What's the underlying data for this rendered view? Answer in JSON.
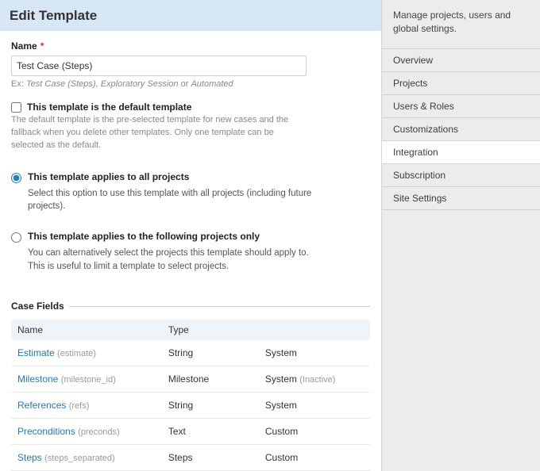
{
  "header": {
    "title": "Edit Template"
  },
  "name": {
    "label": "Name",
    "value": "Test Case (Steps)",
    "hint_prefix": "Ex: ",
    "hint_em": "Test Case (Steps), Exploratory Session",
    "hint_or": " or ",
    "hint_auto": "Automated"
  },
  "default_chk": {
    "label": "This template is the default template",
    "desc": "The default template is the pre-selected template for new cases and the fallback when you delete other templates. Only one template can be selected as the default.",
    "checked": false
  },
  "scope": {
    "all": {
      "label": "This template applies to all projects",
      "desc": "Select this option to use this template with all projects (including future projects)."
    },
    "some": {
      "label": "This template applies to the following projects only",
      "desc": "You can alternatively select the projects this template should apply to. This is useful to limit a template to select projects."
    },
    "selected": "all"
  },
  "case_fields": {
    "legend": "Case Fields",
    "columns": {
      "name": "Name",
      "type": "Type",
      "source": ""
    },
    "rows": [
      {
        "label": "Estimate",
        "system_name": "(estimate)",
        "type": "String",
        "source": "System",
        "inactive": ""
      },
      {
        "label": "Milestone",
        "system_name": "(milestone_id)",
        "type": "Milestone",
        "source": "System",
        "inactive": "(Inactive)"
      },
      {
        "label": "References",
        "system_name": "(refs)",
        "type": "String",
        "source": "System",
        "inactive": ""
      },
      {
        "label": "Preconditions",
        "system_name": "(preconds)",
        "type": "Text",
        "source": "Custom",
        "inactive": ""
      },
      {
        "label": "Steps",
        "system_name": "(steps_separated)",
        "type": "Steps",
        "source": "Custom",
        "inactive": ""
      }
    ]
  },
  "sidebar": {
    "title": "Manage projects, users and global settings.",
    "items": [
      {
        "label": "Overview",
        "active": false
      },
      {
        "label": "Projects",
        "active": false
      },
      {
        "label": "Users & Roles",
        "active": false
      },
      {
        "label": "Customizations",
        "active": false
      },
      {
        "label": "Integration",
        "active": true
      },
      {
        "label": "Subscription",
        "active": false
      },
      {
        "label": "Site Settings",
        "active": false
      }
    ]
  }
}
